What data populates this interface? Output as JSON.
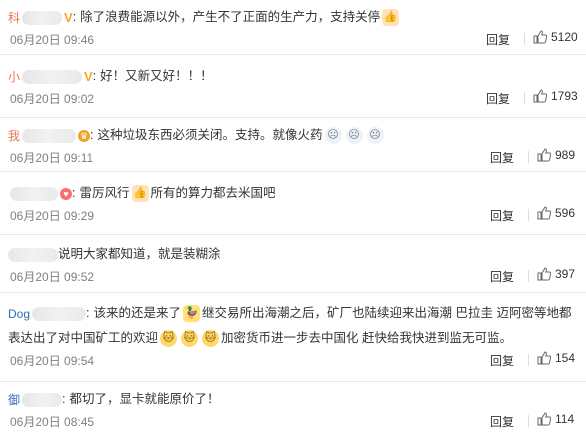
{
  "ui": {
    "reply_label": "回复"
  },
  "comments": [
    {
      "user_prefix": "科",
      "badge_char": "V",
      "text": "除了浪费能源以外，产生不了正面的生产力，支持关停",
      "time": "06月20日 09:46",
      "likes": "5120"
    },
    {
      "user_prefix": "小",
      "badge_char": "V",
      "text": "好！又新又好！！！",
      "time": "06月20日 09:02",
      "likes": "1793"
    },
    {
      "user_prefix": "我",
      "badge_char": "♛",
      "text": "这种垃圾东西必须关闭。支持。就像火药",
      "time": "06月20日 09:11",
      "likes": "989"
    },
    {
      "user_prefix": "",
      "badge_char": "♥",
      "text_before": "雷厉风行",
      "text": "所有的算力都去米国吧",
      "time": "06月20日 09:29",
      "likes": "596"
    },
    {
      "user_prefix": "",
      "badge_char": "",
      "text": "说明大家都知道，就是装糊涂",
      "time": "06月20日 09:52",
      "likes": "397"
    },
    {
      "user_prefix": "Dog",
      "badge_char": "",
      "text_a": "该来的还是来了",
      "text_b": "继交易所出海潮之后，矿厂也陆续迎来出海潮 巴拉圭 迈阿密等地都表达出了对中国矿工的欢迎",
      "text_c": "加密货币进一步去中国化 赶快给我快进到监无可监。",
      "time": "06月20日 09:54",
      "likes": "154"
    },
    {
      "user_prefix": "御",
      "badge_char": "",
      "text": "都切了，显卡就能原价了！",
      "time": "06月20日 08:45",
      "likes": "114"
    }
  ]
}
